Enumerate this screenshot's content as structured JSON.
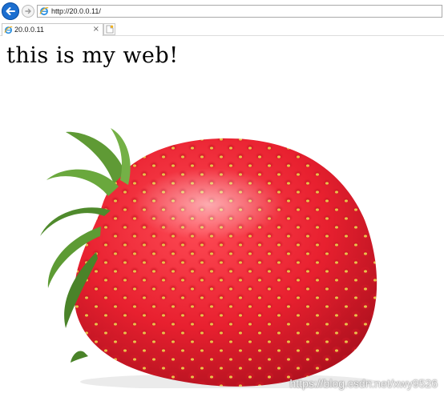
{
  "browser": {
    "address": "http://20.0.0.11/",
    "tab_title": "20.0.0.11",
    "tab_close": "×",
    "icons": {
      "back": "back-arrow-icon",
      "forward": "forward-arrow-icon",
      "site": "internet-explorer-icon",
      "new_tab": "new-tab-icon"
    },
    "colors": {
      "back_button": "#1b6ed0"
    }
  },
  "page": {
    "heading": "this is my web!",
    "image": "strawberry photo",
    "watermark": "https://blog.csdn.net/xwy9526"
  }
}
